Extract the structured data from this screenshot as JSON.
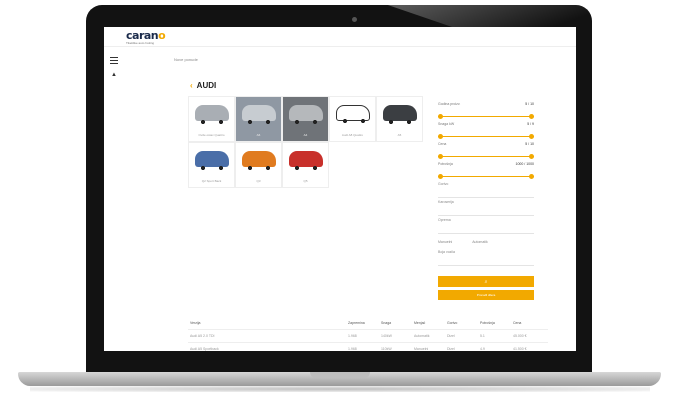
{
  "brand": {
    "logo_main": "caran",
    "logo_accent": "o",
    "tagline": "Tiketiške auto hošing"
  },
  "nav": {
    "breadcrumb": "Nove ponude"
  },
  "catalog": {
    "title": "AUDI",
    "models": [
      {
        "label": "Ovde ostav Quattro"
      },
      {
        "label": "A6"
      },
      {
        "label": "A4"
      },
      {
        "label": "Audi A8 Quattro"
      },
      {
        "label": "A5"
      },
      {
        "label": "Q2 Sport Back"
      },
      {
        "label": "Q3"
      },
      {
        "label": "Q5"
      }
    ]
  },
  "filters": {
    "rows": [
      {
        "label": "Godina proizv.",
        "value": "5 / 10"
      },
      {
        "label": "Snaga kW",
        "value": "5 / 9"
      },
      {
        "label": "Cena",
        "value": "5 / 10"
      },
      {
        "label": "Potrošnja",
        "value": "1000 / 1000"
      }
    ],
    "field_sub": "Gorivo",
    "field_1": "Karoserija",
    "field_2": "Oprema",
    "check_1": "Manuelni",
    "check_2": "Automatik",
    "field_3": "Boja vozila",
    "search_icon": "search-icon",
    "search_label": "⌕",
    "dealer_label": "Pronađi dilera"
  },
  "table": {
    "headers": [
      "Verzija",
      "Zapremina",
      "Snaga",
      "Menjač",
      "Gorivo",
      "Potrošnja",
      "Cena"
    ],
    "rows": [
      [
        "Audi A5 2.0 TDI",
        "1.968",
        "140kW",
        "Automatik",
        "Dizel",
        "5.1",
        "45.000 €"
      ],
      [
        "Audi A5 Sportback",
        "1.968",
        "110kW",
        "Manuelni",
        "Dizel",
        "4.9",
        "41.500 €"
      ]
    ]
  },
  "colors": {
    "accent": "#f2a900",
    "logo": "#1a2a4a"
  }
}
